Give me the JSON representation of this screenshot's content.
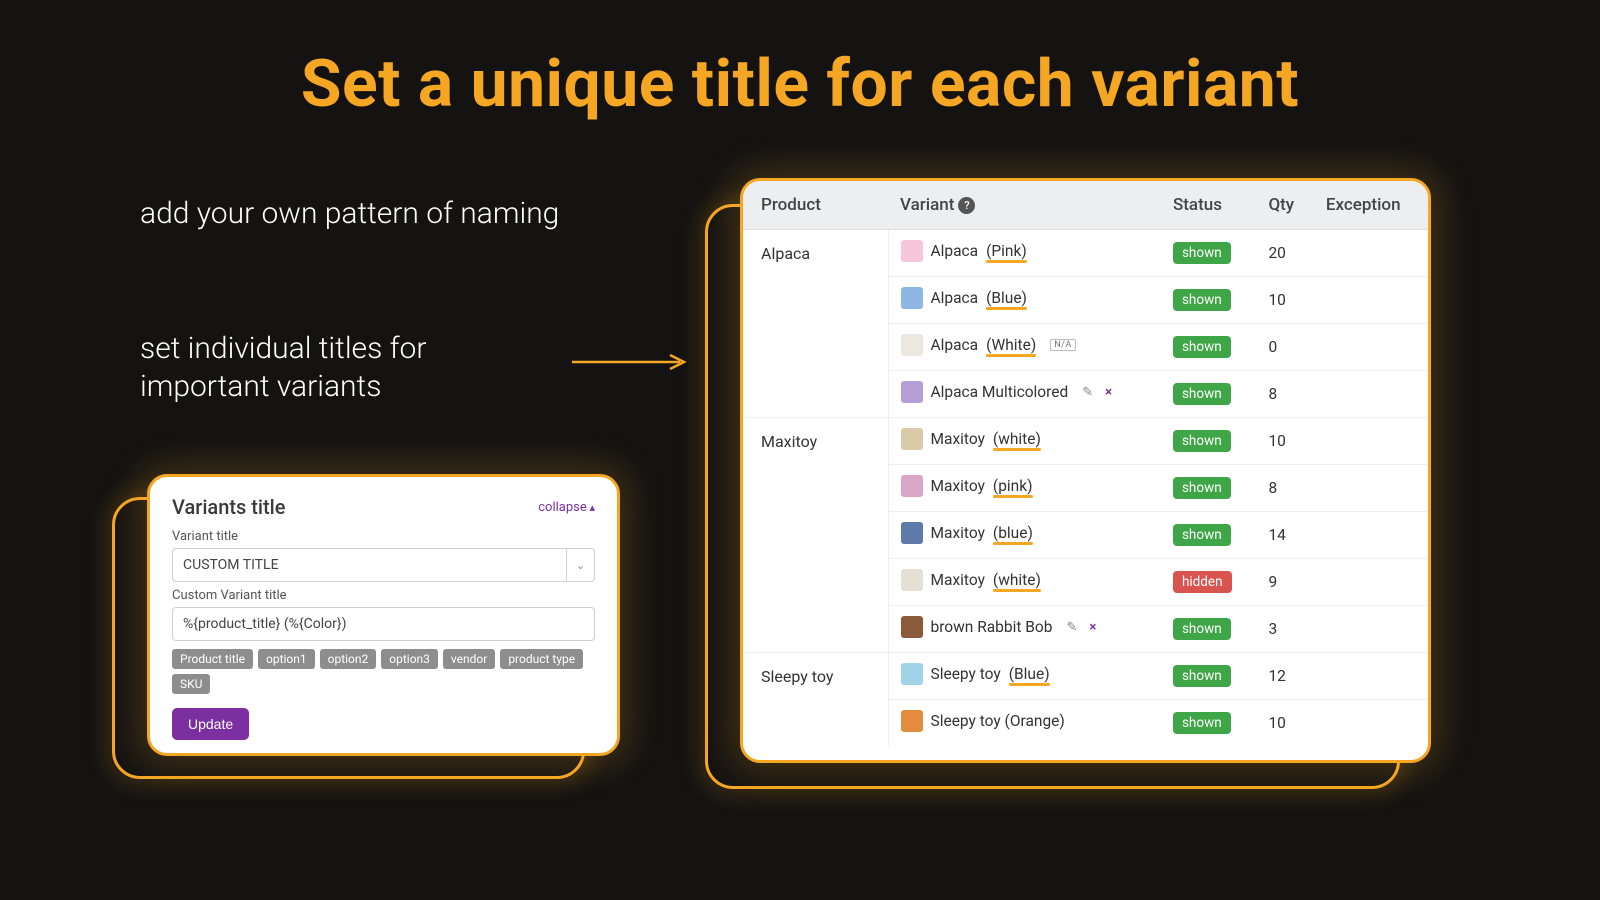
{
  "hero": "Set a unique title for each variant",
  "caption1": "add your own pattern of naming",
  "caption2": "set individual titles for important variants",
  "left": {
    "panel_title": "Variants title",
    "collapse": "collapse",
    "field1_label": "Variant title",
    "select_value": "CUSTOM TITLE",
    "field2_label": "Custom Variant title",
    "input_value": "%{product_title} (%{Color})",
    "tags": [
      "Product title",
      "option1",
      "option2",
      "option3",
      "vendor",
      "product type",
      "SKU"
    ],
    "update": "Update"
  },
  "table": {
    "headers": {
      "product": "Product",
      "variant": "Variant",
      "status": "Status",
      "qty": "Qty",
      "exception": "Exception"
    },
    "groups": [
      {
        "product": "Alpaca",
        "rows": [
          {
            "name": "Alpaca",
            "suffix": "(Pink)",
            "underline": true,
            "status": "shown",
            "qty": "20",
            "thumb": "#f5c6d9"
          },
          {
            "name": "Alpaca",
            "suffix": "(Blue)",
            "underline": true,
            "status": "shown",
            "qty": "10",
            "thumb": "#8fb7e3"
          },
          {
            "name": "Alpaca",
            "suffix": "(White)",
            "underline": true,
            "na": true,
            "status": "shown",
            "qty": "0",
            "thumb": "#ece8e0"
          },
          {
            "name": "Alpaca Multicolored",
            "suffix": "",
            "underline": false,
            "edit": true,
            "del": true,
            "status": "shown",
            "qty": "8",
            "thumb": "#b59fd6"
          }
        ]
      },
      {
        "product": "Maxitoy",
        "rows": [
          {
            "name": "Maxitoy",
            "suffix": "(white)",
            "underline": true,
            "status": "shown",
            "qty": "10",
            "thumb": "#d9cba7"
          },
          {
            "name": "Maxitoy",
            "suffix": "(pink)",
            "underline": true,
            "status": "shown",
            "qty": "8",
            "thumb": "#d8a6c6"
          },
          {
            "name": "Maxitoy",
            "suffix": "(blue)",
            "underline": true,
            "status": "shown",
            "qty": "14",
            "thumb": "#5d7aa8"
          },
          {
            "name": "Maxitoy",
            "suffix": "(white)",
            "underline": true,
            "status": "hidden",
            "qty": "9",
            "thumb": "#e6e0d4"
          },
          {
            "name": "brown Rabbit Bob",
            "suffix": "",
            "underline": false,
            "edit": true,
            "del": true,
            "status": "shown",
            "qty": "3",
            "thumb": "#8b5a3a"
          }
        ]
      },
      {
        "product": "Sleepy toy",
        "rows": [
          {
            "name": "Sleepy toy",
            "suffix": "(Blue)",
            "underline": true,
            "status": "shown",
            "qty": "12",
            "thumb": "#9fd4e6"
          },
          {
            "name": "Sleepy toy (Orange)",
            "suffix": "",
            "underline": false,
            "status": "shown",
            "qty": "10",
            "thumb": "#e38b3f"
          }
        ]
      }
    ]
  }
}
